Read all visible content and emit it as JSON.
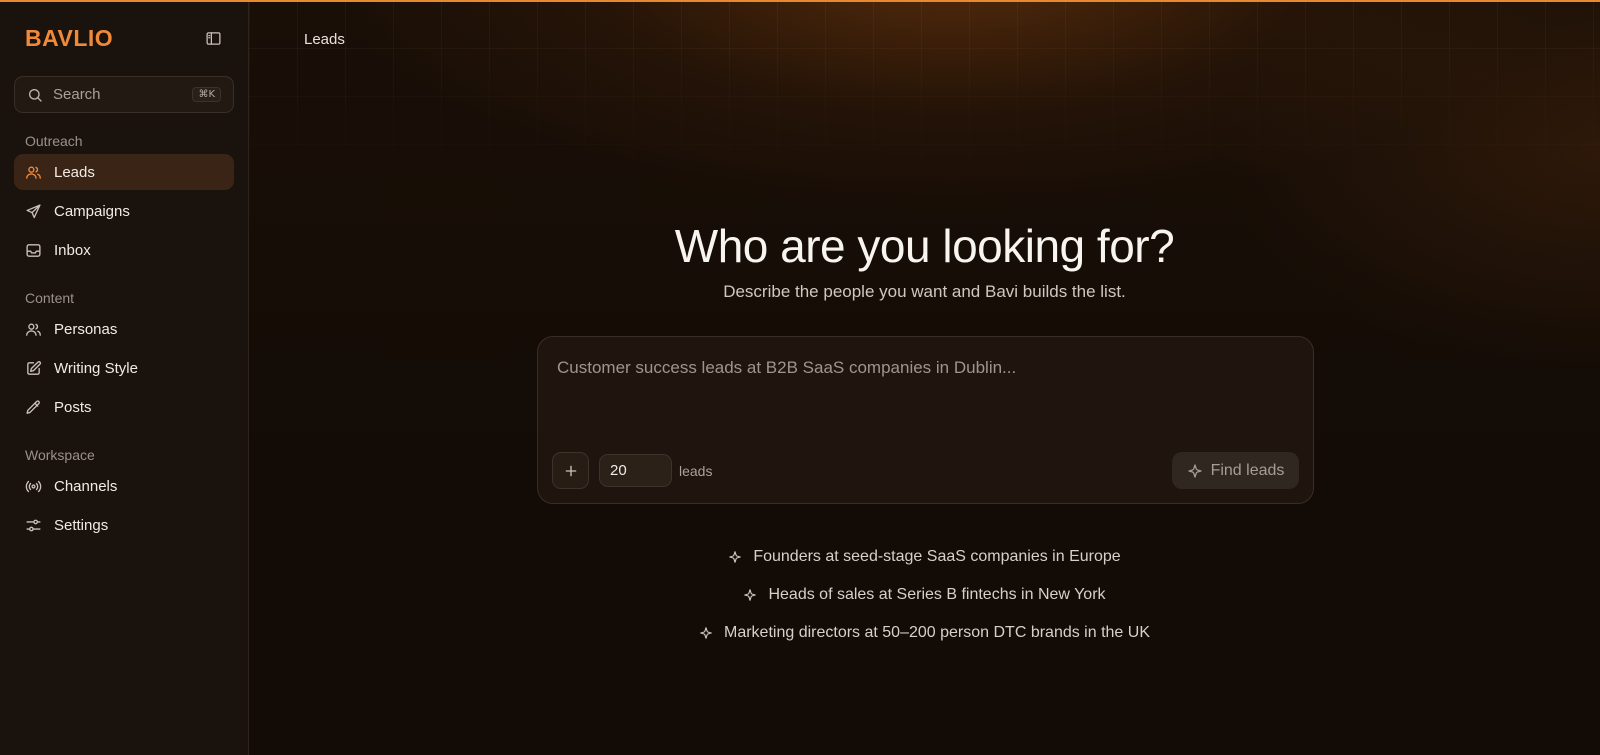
{
  "app": {
    "logo": "BAVLIO"
  },
  "sidebar": {
    "search": {
      "placeholder": "Search",
      "shortcut": "⌘K"
    },
    "sections": [
      {
        "label": "Outreach",
        "items": [
          {
            "label": "Leads",
            "icon": "users-icon",
            "active": true
          },
          {
            "label": "Campaigns",
            "icon": "send-icon"
          },
          {
            "label": "Inbox",
            "icon": "inbox-icon"
          }
        ]
      },
      {
        "label": "Content",
        "items": [
          {
            "label": "Personas",
            "icon": "users-icon"
          },
          {
            "label": "Writing Style",
            "icon": "edit-square-icon"
          },
          {
            "label": "Posts",
            "icon": "pencil-icon"
          }
        ]
      },
      {
        "label": "Workspace",
        "items": [
          {
            "label": "Channels",
            "icon": "broadcast-icon"
          },
          {
            "label": "Settings",
            "icon": "sliders-icon"
          }
        ]
      }
    ]
  },
  "header": {
    "breadcrumb": "Leads"
  },
  "hero": {
    "title": "Who are you looking for?",
    "subtitle": "Describe the people you want and Bavi builds the list."
  },
  "composer": {
    "placeholder": "Customer success leads at B2B SaaS companies in Dublin...",
    "count": "20",
    "count_unit": "leads",
    "submit_label": "Find leads"
  },
  "suggestions": [
    "Founders at seed-stage SaaS companies in Europe",
    "Heads of sales at Series B fintechs in New York",
    "Marketing directors at 50–200 person DTC brands in the UK"
  ],
  "colors": {
    "accent": "#f08a3a",
    "background": "#120b06",
    "sidebar": "#1a120c"
  }
}
